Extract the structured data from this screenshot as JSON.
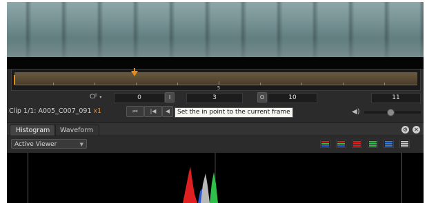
{
  "timeline": {
    "tick_label_5": "5"
  },
  "frames": {
    "cf_label": "CF",
    "cf_arrow": "▾",
    "current_frame": "0",
    "in_button": "I",
    "in_point": "3",
    "out_button": "O",
    "out_point": "10",
    "total": "11"
  },
  "clip": {
    "label": "Clip 1/1: A005_C007_091",
    "multiplier": "x1"
  },
  "transport": {
    "buttons": [
      {
        "name": "go-to-start-icon",
        "glyph": "⏮"
      },
      {
        "name": "step-back-icon",
        "glyph": "|◀"
      },
      {
        "name": "play-backward-icon",
        "glyph": "◀"
      }
    ]
  },
  "tooltip": {
    "text": "Set the in point to the current frame"
  },
  "audio": {
    "volume_icon": "◀)",
    "volume_level": 0.45
  },
  "tabs": [
    {
      "label": "Histogram",
      "active": true
    },
    {
      "label": "Waveform",
      "active": false
    }
  ],
  "panel_icons": [
    "settings-icon",
    "close-icon"
  ],
  "toolbar": {
    "viewer_select": "Active Viewer",
    "channel_buttons": [
      "rgb-overlay",
      "rgb-parade-1",
      "red",
      "green",
      "luma",
      "white"
    ]
  },
  "colors": {
    "accent": "#e88a1a",
    "red": "#e02020",
    "green": "#2fbf4a",
    "blue": "#2a5ad8",
    "luma": "#c8c8c8"
  }
}
